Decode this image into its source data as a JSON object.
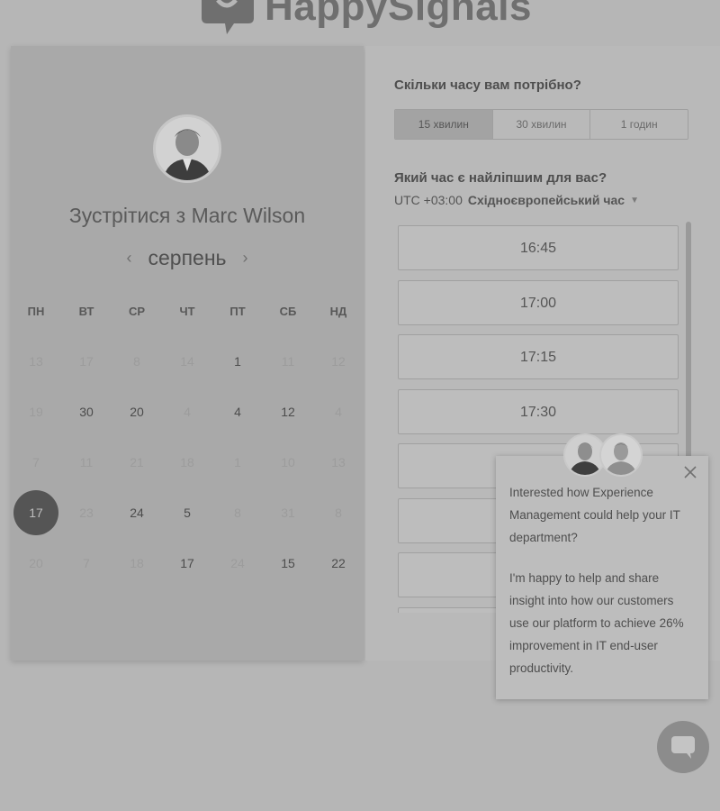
{
  "brand": {
    "name": "HappySignals",
    "logo_icon": "speech-bubble-heart-icon"
  },
  "scheduler": {
    "meet_prefix": "Зустрітися з",
    "host_name": "Marc Wilson",
    "month": "серпень",
    "prev_icon": "chevron-left-icon",
    "next_icon": "chevron-right-icon",
    "weekdays": [
      "ПН",
      "ВТ",
      "СР",
      "ЧТ",
      "ПТ",
      "СБ",
      "НД"
    ],
    "weeks": [
      [
        {
          "d": "13",
          "s": "muted"
        },
        {
          "d": "17",
          "s": "muted"
        },
        {
          "d": "8",
          "s": "muted"
        },
        {
          "d": "14",
          "s": "muted"
        },
        {
          "d": "1",
          "s": "avail"
        },
        {
          "d": "11",
          "s": "muted"
        },
        {
          "d": "12",
          "s": "muted"
        }
      ],
      [
        {
          "d": "19",
          "s": "muted"
        },
        {
          "d": "30",
          "s": "avail"
        },
        {
          "d": "20",
          "s": "avail"
        },
        {
          "d": "4",
          "s": "muted"
        },
        {
          "d": "4",
          "s": "avail"
        },
        {
          "d": "12",
          "s": "avail"
        },
        {
          "d": "4",
          "s": "muted"
        }
      ],
      [
        {
          "d": "7",
          "s": "muted"
        },
        {
          "d": "11",
          "s": "muted"
        },
        {
          "d": "21",
          "s": "muted"
        },
        {
          "d": "18",
          "s": "muted"
        },
        {
          "d": "1",
          "s": "muted"
        },
        {
          "d": "10",
          "s": "muted"
        },
        {
          "d": "13",
          "s": "muted"
        }
      ],
      [
        {
          "d": "17",
          "s": "selected"
        },
        {
          "d": "23",
          "s": "muted"
        },
        {
          "d": "24",
          "s": "avail"
        },
        {
          "d": "5",
          "s": "avail"
        },
        {
          "d": "8",
          "s": "muted"
        },
        {
          "d": "31",
          "s": "muted"
        },
        {
          "d": "8",
          "s": "muted"
        }
      ],
      [
        {
          "d": "20",
          "s": "muted"
        },
        {
          "d": "7",
          "s": "muted"
        },
        {
          "d": "18",
          "s": "muted"
        },
        {
          "d": "17",
          "s": "avail"
        },
        {
          "d": "24",
          "s": "muted"
        },
        {
          "d": "15",
          "s": "avail"
        },
        {
          "d": "22",
          "s": "avail"
        }
      ]
    ]
  },
  "booking": {
    "duration_question": "Скільки часу вам потрібно?",
    "durations": [
      "15 хвилин",
      "30 хвилин",
      "1 годин"
    ],
    "selected_duration": 0,
    "time_question": "Який час є найліпшим для вас?",
    "timezone_offset": "UTC +03:00",
    "timezone_name": "Східноєвропейський час",
    "timezone_caret_icon": "caret-down-icon",
    "slots": [
      "16:45",
      "17:00",
      "17:15",
      "17:30",
      "",
      "",
      "",
      ""
    ]
  },
  "chat_popup": {
    "message_1": "Interested how Experience Management could help your IT department?",
    "message_2": "I'm happy to help and share insight into how our customers use our platform to achieve 26% improvement in IT end-user productivity.",
    "close_icon": "close-icon",
    "launcher_icon": "chat-bubble-icon"
  }
}
